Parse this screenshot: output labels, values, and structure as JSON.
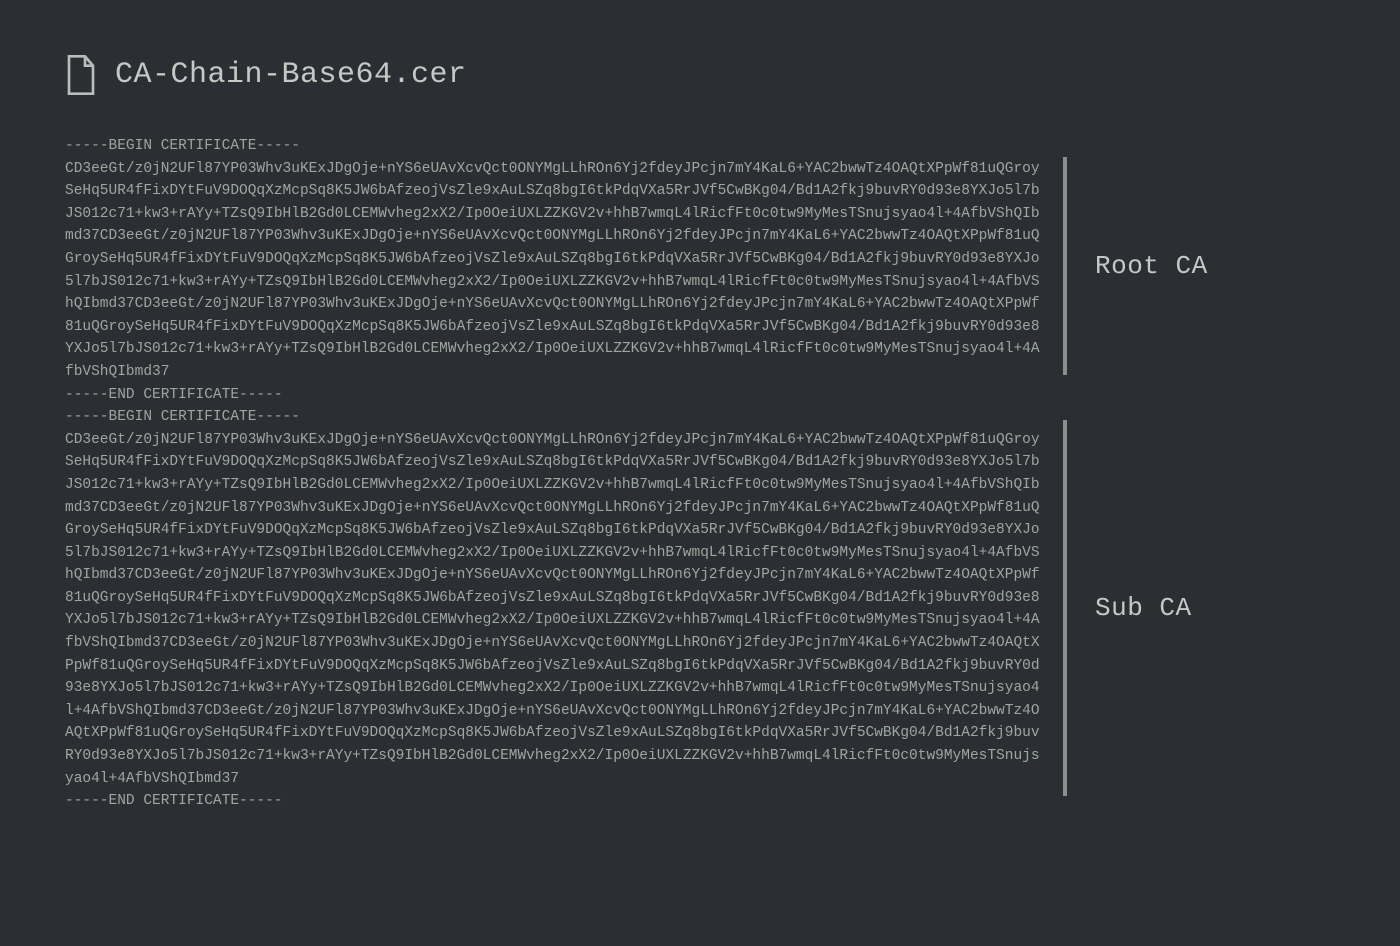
{
  "header": {
    "filename": "CA-Chain-Base64.cer"
  },
  "certificates": {
    "root": {
      "label": "Root CA",
      "begin": "-----BEGIN CERTIFICATE-----",
      "body": "CD3eeGt/z0jN2UFl87YP03Whv3uKExJDgOje+nYS6eUAvXcvQct0ONYMgLLhROn6Yj2fdeyJPcjn7mY4KaL6+YAC2bwwTz4OAQtXPpWf81uQGroySeHq5UR4fFixDYtFuV9DOQqXzMcpSq8K5JW6bAfzeojVsZle9xAuLSZq8bgI6tkPdqVXa5RrJVf5CwBKg04/Bd1A2fkj9buvRY0d93e8YXJo5l7bJS012c71+kw3+rAYy+TZsQ9IbHlB2Gd0LCEMWvheg2xX2/Ip0OeiUXLZZKGV2v+hhB7wmqL4lRicfFt0c0tw9MyMesTSnujsyao4l+4AfbVShQIbmd37CD3eeGt/z0jN2UFl87YP03Whv3uKExJDgOje+nYS6eUAvXcvQct0ONYMgLLhROn6Yj2fdeyJPcjn7mY4KaL6+YAC2bwwTz4OAQtXPpWf81uQGroySeHq5UR4fFixDYtFuV9DOQqXzMcpSq8K5JW6bAfzeojVsZle9xAuLSZq8bgI6tkPdqVXa5RrJVf5CwBKg04/Bd1A2fkj9buvRY0d93e8YXJo5l7bJS012c71+kw3+rAYy+TZsQ9IbHlB2Gd0LCEMWvheg2xX2/Ip0OeiUXLZZKGV2v+hhB7wmqL4lRicfFt0c0tw9MyMesTSnujsyao4l+4AfbVShQIbmd37CD3eeGt/z0jN2UFl87YP03Whv3uKExJDgOje+nYS6eUAvXcvQct0ONYMgLLhROn6Yj2fdeyJPcjn7mY4KaL6+YAC2bwwTz4OAQtXPpWf81uQGroySeHq5UR4fFixDYtFuV9DOQqXzMcpSq8K5JW6bAfzeojVsZle9xAuLSZq8bgI6tkPdqVXa5RrJVf5CwBKg04/Bd1A2fkj9buvRY0d93e8YXJo5l7bJS012c71+kw3+rAYy+TZsQ9IbHlB2Gd0LCEMWvheg2xX2/Ip0OeiUXLZZKGV2v+hhB7wmqL4lRicfFt0c0tw9MyMesTSnujsyao4l+4AfbVShQIbmd37",
      "end": "-----END CERTIFICATE-----"
    },
    "sub": {
      "label": "Sub CA",
      "begin": "-----BEGIN CERTIFICATE-----",
      "body": "CD3eeGt/z0jN2UFl87YP03Whv3uKExJDgOje+nYS6eUAvXcvQct0ONYMgLLhROn6Yj2fdeyJPcjn7mY4KaL6+YAC2bwwTz4OAQtXPpWf81uQGroySeHq5UR4fFixDYtFuV9DOQqXzMcpSq8K5JW6bAfzeojVsZle9xAuLSZq8bgI6tkPdqVXa5RrJVf5CwBKg04/Bd1A2fkj9buvRY0d93e8YXJo5l7bJS012c71+kw3+rAYy+TZsQ9IbHlB2Gd0LCEMWvheg2xX2/Ip0OeiUXLZZKGV2v+hhB7wmqL4lRicfFt0c0tw9MyMesTSnujsyao4l+4AfbVShQIbmd37CD3eeGt/z0jN2UFl87YP03Whv3uKExJDgOje+nYS6eUAvXcvQct0ONYMgLLhROn6Yj2fdeyJPcjn7mY4KaL6+YAC2bwwTz4OAQtXPpWf81uQGroySeHq5UR4fFixDYtFuV9DOQqXzMcpSq8K5JW6bAfzeojVsZle9xAuLSZq8bgI6tkPdqVXa5RrJVf5CwBKg04/Bd1A2fkj9buvRY0d93e8YXJo5l7bJS012c71+kw3+rAYy+TZsQ9IbHlB2Gd0LCEMWvheg2xX2/Ip0OeiUXLZZKGV2v+hhB7wmqL4lRicfFt0c0tw9MyMesTSnujsyao4l+4AfbVShQIbmd37CD3eeGt/z0jN2UFl87YP03Whv3uKExJDgOje+nYS6eUAvXcvQct0ONYMgLLhROn6Yj2fdeyJPcjn7mY4KaL6+YAC2bwwTz4OAQtXPpWf81uQGroySeHq5UR4fFixDYtFuV9DOQqXzMcpSq8K5JW6bAfzeojVsZle9xAuLSZq8bgI6tkPdqVXa5RrJVf5CwBKg04/Bd1A2fkj9buvRY0d93e8YXJo5l7bJS012c71+kw3+rAYy+TZsQ9IbHlB2Gd0LCEMWvheg2xX2/Ip0OeiUXLZZKGV2v+hhB7wmqL4lRicfFt0c0tw9MyMesTSnujsyao4l+4AfbVShQIbmd37CD3eeGt/z0jN2UFl87YP03Whv3uKExJDgOje+nYS6eUAvXcvQct0ONYMgLLhROn6Yj2fdeyJPcjn7mY4KaL6+YAC2bwwTz4OAQtXPpWf81uQGroySeHq5UR4fFixDYtFuV9DOQqXzMcpSq8K5JW6bAfzeojVsZle9xAuLSZq8bgI6tkPdqVXa5RrJVf5CwBKg04/Bd1A2fkj9buvRY0d93e8YXJo5l7bJS012c71+kw3+rAYy+TZsQ9IbHlB2Gd0LCEMWvheg2xX2/Ip0OeiUXLZZKGV2v+hhB7wmqL4lRicfFt0c0tw9MyMesTSnujsyao4l+4AfbVShQIbmd37CD3eeGt/z0jN2UFl87YP03Whv3uKExJDgOje+nYS6eUAvXcvQct0ONYMgLLhROn6Yj2fdeyJPcjn7mY4KaL6+YAC2bwwTz4OAQtXPpWf81uQGroySeHq5UR4fFixDYtFuV9DOQqXzMcpSq8K5JW6bAfzeojVsZle9xAuLSZq8bgI6tkPdqVXa5RrJVf5CwBKg04/Bd1A2fkj9buvRY0d93e8YXJo5l7bJS012c71+kw3+rAYy+TZsQ9IbHlB2Gd0LCEMWvheg2xX2/Ip0OeiUXLZZKGV2v+hhB7wmqL4lRicfFt0c0tw9MyMesTSnujsyao4l+4AfbVShQIbmd37",
      "end": "-----END CERTIFICATE-----"
    }
  }
}
